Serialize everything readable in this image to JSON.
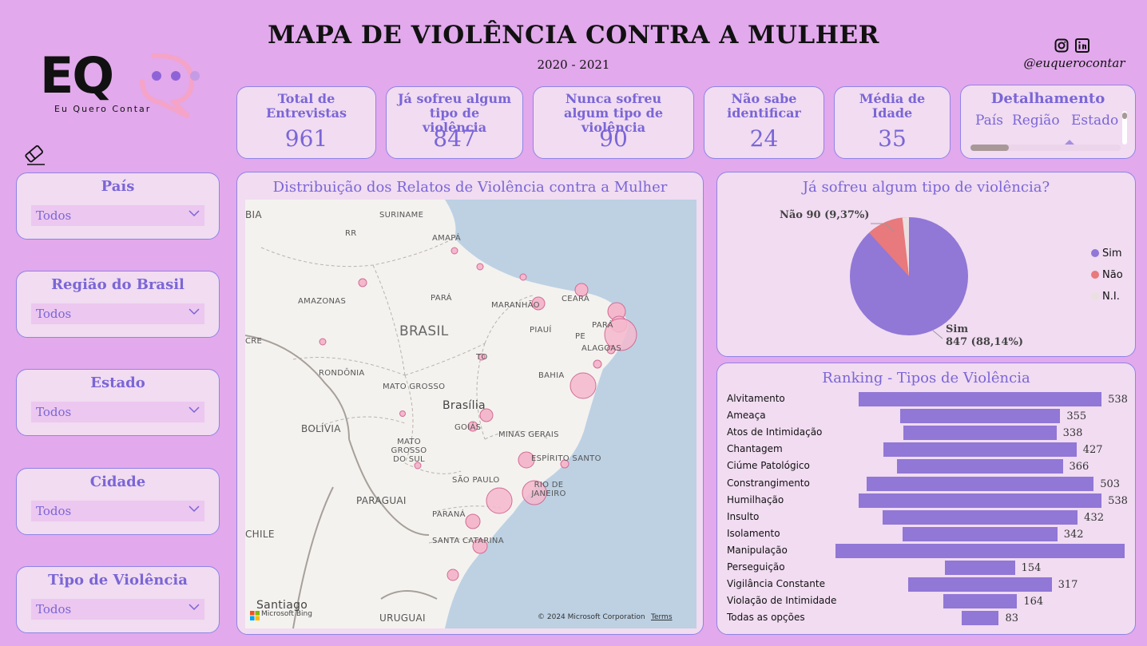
{
  "header": {
    "title": "MAPA DE VIOLÊNCIA CONTRA A MULHER",
    "subtitle": "2020 - 2021",
    "handle": "@euquerocontar"
  },
  "logo": {
    "letters": "EQ",
    "tagline": "Eu Quero Contar"
  },
  "kpis": [
    {
      "label": "Total de Entrevistas",
      "value": "961"
    },
    {
      "label": "Já sofreu algum tipo de violência",
      "value": "847"
    },
    {
      "label": "Nunca sofreu algum tipo de violência",
      "value": "90"
    },
    {
      "label": "Não sabe identificar",
      "value": "24"
    },
    {
      "label": "Média de Idade",
      "value": "35"
    }
  ],
  "detail": {
    "title": "Detalhamento",
    "options": [
      "País",
      "Região",
      "Estado"
    ]
  },
  "filters": [
    {
      "title": "País",
      "value": "Todos"
    },
    {
      "title": "Região do Brasil",
      "value": "Todos"
    },
    {
      "title": "Estado",
      "value": "Todos"
    },
    {
      "title": "Cidade",
      "value": "Todos"
    },
    {
      "title": "Tipo de Violência",
      "value": "Todos"
    }
  ],
  "map": {
    "title": "Distribuição dos Relatos de Violência contra a Mulher",
    "labels": [
      "SURINAME",
      "AMAPÁ",
      "RR",
      "AMAZONAS",
      "PARÁ",
      "MARANHÃO",
      "CEARÁ",
      "BRASIL",
      "PIAUÍ",
      "PE",
      "ALAGOAS",
      "TO",
      "BAHIA",
      "RONDÔNIA",
      "MATO GROSSO",
      "Brasília",
      "GOIÁS",
      "MINAS GERAIS",
      "BOLÍVIA",
      "MATO GROSSO DO SUL",
      "ESPÍRITO SANTO",
      "SÃO PAULO",
      "RIO DE JANEIRO",
      "PARAGUAI",
      "PARANÁ",
      "SANTA CATARINA",
      "CHILE",
      "URUGUAI",
      "Santiago",
      "BIA",
      "CRE",
      "PARÁ"
    ],
    "attribution": "© 2024 Microsoft Corporation",
    "terms": "Terms",
    "bing": "Microsoft Bing"
  },
  "pie": {
    "title": "Já sofreu algum tipo de violência?",
    "label_nao": "Não 90 (9,37%)",
    "label_sim_name": "Sim",
    "label_sim_value": "847 (88,14%)",
    "legend": [
      {
        "name": "Sim",
        "color": "#9177d6"
      },
      {
        "name": "Não",
        "color": "#e8797c"
      },
      {
        "name": "N.I.",
        "color": "#eae0e0"
      }
    ]
  },
  "chart_data": {
    "type": "bar",
    "title": "Ranking - Tipos de Violência",
    "categories": [
      "Alvitamento",
      "Ameaça",
      "Atos de Intimidação",
      "Chantagem",
      "Ciúme Patológico",
      "Constrangimento",
      "Humilhação",
      "Insulto",
      "Isolamento",
      "Manipulação",
      "Perseguição",
      "Vigilância Constante",
      "Violação de Intimidade",
      "Todas as opções"
    ],
    "values": [
      538,
      355,
      338,
      427,
      366,
      503,
      538,
      432,
      342,
      640,
      154,
      317,
      164,
      83
    ],
    "value_labels": [
      "538",
      "355",
      "338",
      "427",
      "366",
      "503",
      "538",
      "432",
      "342",
      "",
      "154",
      "317",
      "164",
      "83"
    ],
    "orientation": "horizontal-centered"
  },
  "colors": {
    "background": "#e2a9ec",
    "card": "#f1dcf1",
    "accent": "#7a66d6",
    "bar": "#9177d6",
    "bubble": "#f4b8cc"
  }
}
